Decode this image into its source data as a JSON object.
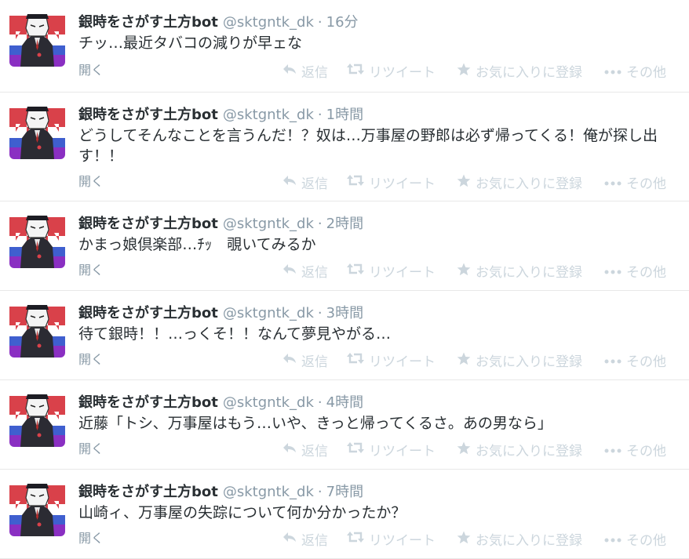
{
  "tweets": [
    {
      "name": "銀時をさがす土方bot",
      "handle": "@sktgntk_dk",
      "time": "16分",
      "text": "チッ…最近タバコの減りが早ェな"
    },
    {
      "name": "銀時をさがす土方bot",
      "handle": "@sktgntk_dk",
      "time": "1時間",
      "text": "どうしてそんなことを言うんだ！？奴は…万事屋の野郎は必ず帰ってくる！俺が探し出す！！"
    },
    {
      "name": "銀時をさがす土方bot",
      "handle": "@sktgntk_dk",
      "time": "2時間",
      "text": "かまっ娘倶楽部…ﾁｯ　覗いてみるか"
    },
    {
      "name": "銀時をさがす土方bot",
      "handle": "@sktgntk_dk",
      "time": "3時間",
      "text": "待て銀時！！…っくそ！！なんて夢見やがる…"
    },
    {
      "name": "銀時をさがす土方bot",
      "handle": "@sktgntk_dk",
      "time": "4時間",
      "text": "近藤「トシ、万事屋はもう…いや、きっと帰ってくるさ。あの男なら」"
    },
    {
      "name": "銀時をさがす土方bot",
      "handle": "@sktgntk_dk",
      "time": "7時間",
      "text": "山崎ィ、万事屋の失踪について何か分かったか？"
    }
  ],
  "labels": {
    "separator": "·",
    "open": "開く",
    "reply": "返信",
    "retweet": "リツイート",
    "favorite": "お気に入りに登録",
    "more": "その他"
  },
  "icons": {
    "reply": "reply-arrow-icon",
    "retweet": "retweet-icon",
    "favorite": "star-icon",
    "more": "ellipsis-icon",
    "avatar": "drawn-character-avatar"
  },
  "colors": {
    "name": "#292f33",
    "meta": "#8899a6",
    "action": "#ccd6dd",
    "divider": "#e8e8e8",
    "avatar_red": "#d9414a",
    "avatar_blue": "#3f5fcf",
    "avatar_purple": "#8a2fc2"
  }
}
